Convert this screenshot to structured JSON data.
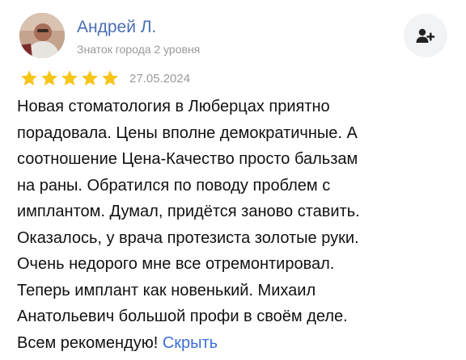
{
  "author": {
    "name": "Андрей Л.",
    "level": "Знаток города 2 уровня"
  },
  "subscribe_icon": "add-user-icon",
  "rating": {
    "value": 5,
    "max": 5,
    "date": "27.05.2024",
    "star_color": "#f5c518"
  },
  "review": {
    "lines": [
      "Новая стоматология в Люберцах приятно",
      "порадовала. Цены вполне демократичные. А",
      "соотношение Цена-Качество просто бальзам",
      "на раны. Обратился по поводу проблем с",
      "имплантом. Думал, придётся заново ставить.",
      "Оказалось, у врача протезиста золотые руки.",
      "Очень недорого мне все отремонтировал.",
      "Теперь имплант как новенький. Михаил",
      "Анатольевич большой профи в своём деле.",
      "Всем рекомендую!"
    ],
    "hide_label": "Скрыть"
  },
  "colors": {
    "name": "#4a6fb5",
    "link": "#3c6fd6",
    "muted": "#9a9a9a"
  }
}
